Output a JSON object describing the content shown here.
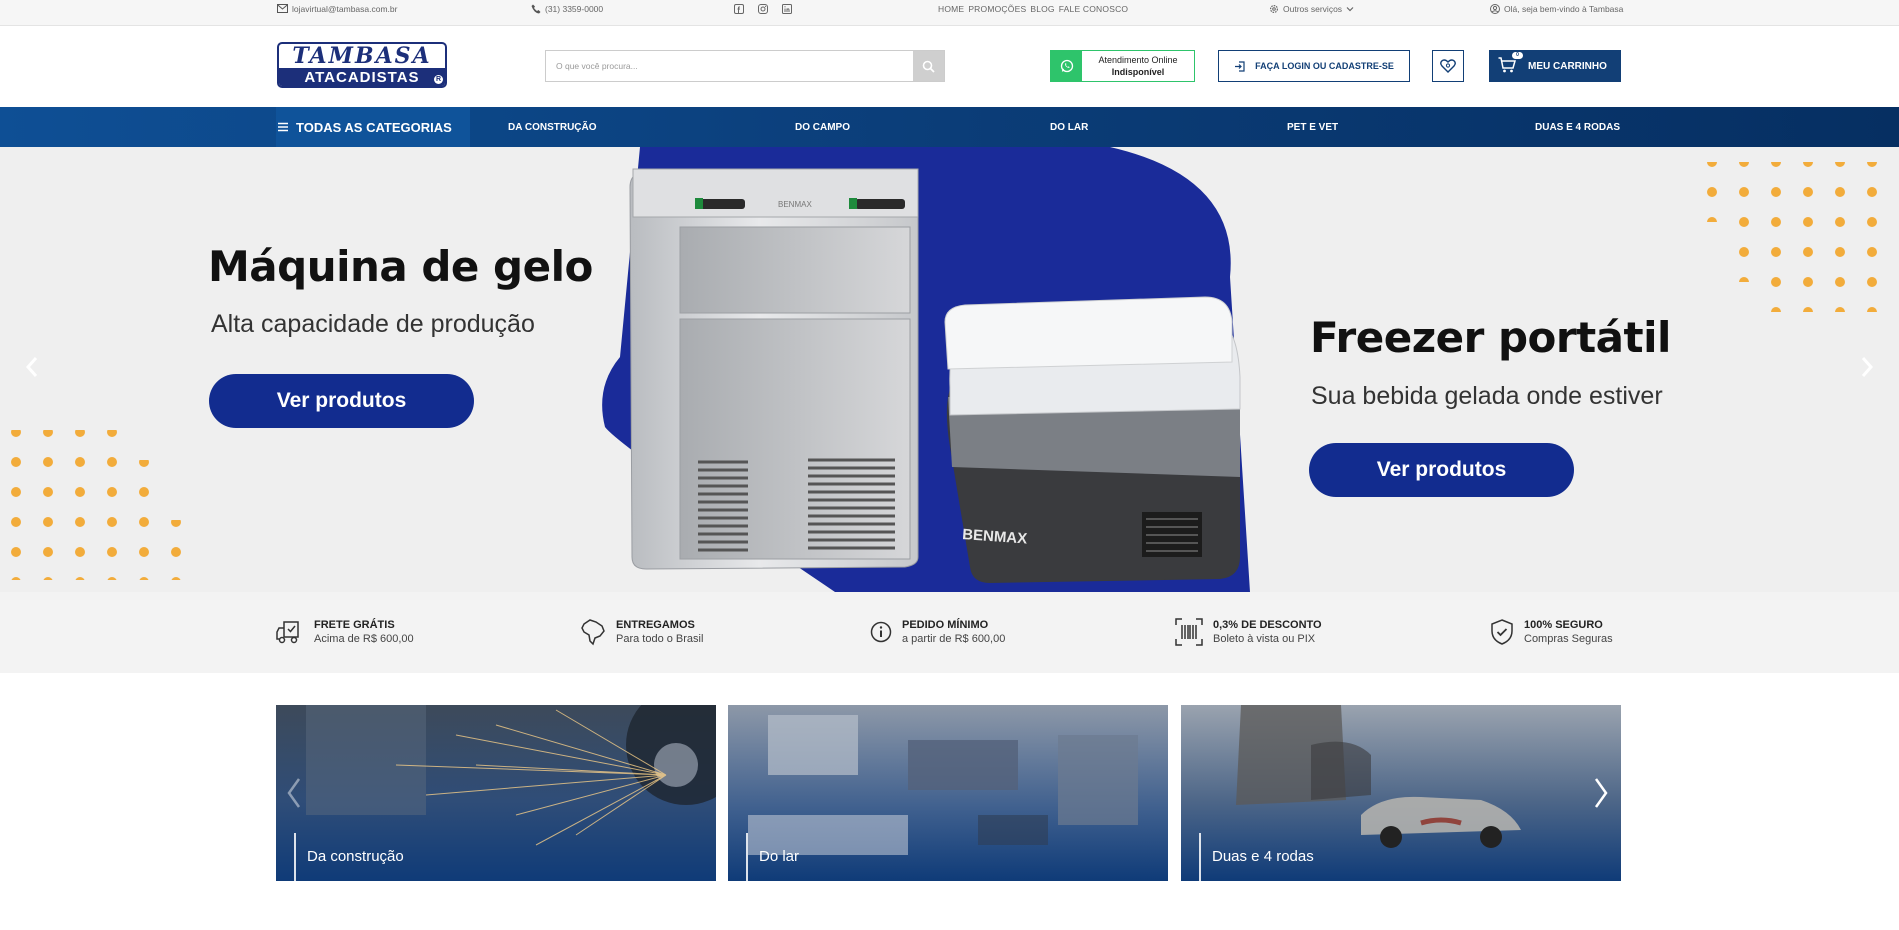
{
  "topbar": {
    "email": "lojavirtual@tambasa.com.br",
    "phone": "(31) 3359-0000",
    "social": [
      "facebook-icon",
      "instagram-icon",
      "linkedin-icon"
    ],
    "nav": [
      "HOME",
      "PROMOÇÕES",
      "BLOG",
      "FALE CONOSCO"
    ],
    "other_services": "Outros serviços",
    "greeting": "Olá, seja bem-vindo à Tambasa"
  },
  "header": {
    "logo_line1": "TAMBASA",
    "logo_line2": "ATACADISTAS",
    "logo_reg": "R",
    "search_placeholder": "O que você procura...",
    "atendimento_title": "Atendimento Online",
    "atendimento_status": "Indisponível",
    "login_label": "FAÇA LOGIN OU CADASTRE-SE",
    "cart_label": "MEU CARRINHO",
    "cart_count": "0"
  },
  "nav": {
    "all_categories": "TODAS AS CATEGORIAS",
    "links": [
      "DA CONSTRUÇÃO",
      "DO CAMPO",
      "DO LAR",
      "PET E VET",
      "DUAS E 4 RODAS"
    ]
  },
  "hero": {
    "left_title": "Máquina de gelo",
    "left_subtitle": "Alta capacidade de produção",
    "left_cta": "Ver produtos",
    "right_title": "Freezer portátil",
    "right_subtitle": "Sua bebida gelada onde estiver",
    "right_cta": "Ver produtos",
    "brand": "BENMAX",
    "accent_color": "#122c8f",
    "dot_color": "#f2ac3b"
  },
  "features": [
    {
      "title": "FRETE GRÁTIS",
      "subtitle": "Acima de R$ 600,00",
      "icon": "truck-icon"
    },
    {
      "title": "ENTREGAMOS",
      "subtitle": "Para todo o Brasil",
      "icon": "brazil-map-icon"
    },
    {
      "title": "PEDIDO MÍNIMO",
      "subtitle": "a partir de R$ 600,00",
      "icon": "info-icon"
    },
    {
      "title": "0,3% DE DESCONTO",
      "subtitle": "Boleto à vista ou PIX",
      "icon": "barcode-icon"
    },
    {
      "title": "100% SEGURO",
      "subtitle": "Compras Seguras",
      "icon": "shield-check-icon"
    }
  ],
  "categories": [
    {
      "label": "Da construção"
    },
    {
      "label": "Do lar"
    },
    {
      "label": "Duas e 4 rodas"
    }
  ],
  "colors": {
    "brand_blue": "#123f76",
    "nav_blue": "#0b3d78",
    "whatsapp_green": "#2ec46b"
  }
}
